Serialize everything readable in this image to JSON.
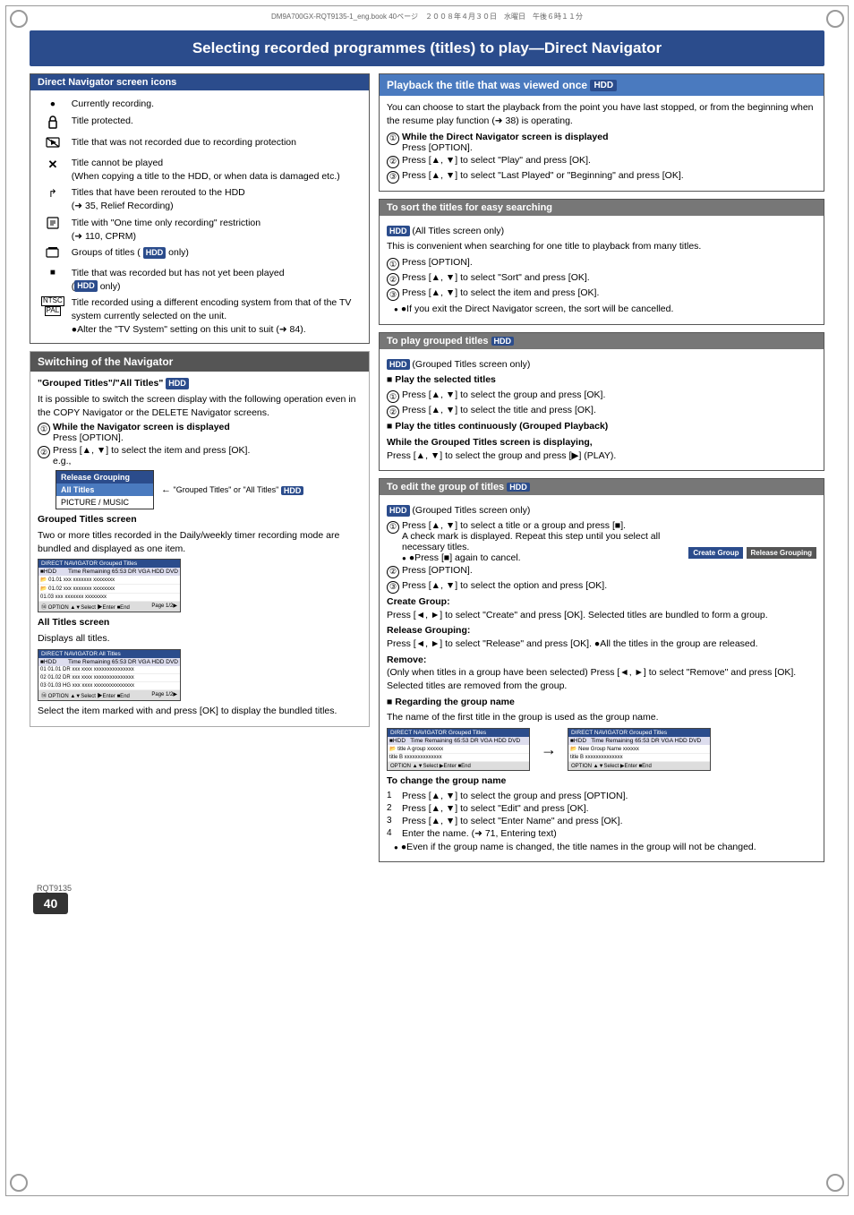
{
  "page": {
    "title": "Selecting recorded programmes (titles) to play—Direct Navigator",
    "meta_line": "DM9A700GX-RQT9135-1_eng.book  40ページ　２００８年４月３０日　水曜日　午後６時１１分",
    "page_number": "40",
    "page_ref": "RQT9135"
  },
  "left": {
    "icons_box": {
      "title": "Direct Navigator screen icons",
      "icons": [
        {
          "icon": "●",
          "description": "Currently recording."
        },
        {
          "icon": "🔒",
          "description": "Title protected."
        },
        {
          "icon": "📷",
          "description": "Title that was not recorded due to recording protection"
        },
        {
          "icon": "✕",
          "description": "Title cannot be played\n(When copying a title to the HDD, or when data is damaged etc.)"
        },
        {
          "icon": "↱",
          "description": "Titles that have been rerouted to the HDD\n(➜ 35, Relief Recording)"
        },
        {
          "icon": "📋",
          "description": "Title with \"One time only recording\" restriction\n(➜ 110, CPRM)"
        },
        {
          "icon": "🔄",
          "description": "Groups of titles ( HDD only)"
        },
        {
          "icon": "▪",
          "description": "Title that was recorded but has not yet been played\n(HDD only)"
        },
        {
          "icon": "NTSC/PAL",
          "description": "Title recorded using a different encoding system from that of the TV system currently selected on the unit.\n●Alter the \"TV System\" setting on this unit to suit (➜ 84)."
        }
      ]
    },
    "switching_box": {
      "title": "Switching of the Navigator",
      "subtitle": "\"Grouped Titles\"/\"All Titles\" HDD",
      "intro": "It is possible to switch the screen display with the following operation even in the COPY Navigator or the DELETE Navigator screens.",
      "steps": [
        {
          "num": "①",
          "text": "While the Navigator screen is displayed\nPress [OPTION]."
        },
        {
          "num": "②",
          "text": "Press [▲, ▼] to select the item and press [OK].\ne.g.,"
        }
      ],
      "caption": "\"Grouped Titles\" or \"All Titles\" HDD",
      "grouped_title_screen": {
        "label": "Grouped Titles screen",
        "description": "Two or more titles recorded in the Daily/weekly timer recording mode are bundled and displayed as one item."
      },
      "all_titles_screen": {
        "label": "All Titles screen",
        "description": "Displays all titles."
      },
      "select_note": "Select the item marked with  and press [OK] to display the bundled titles."
    }
  },
  "right": {
    "playback_box": {
      "title": "Playback the title that was viewed once",
      "hdd": "HDD",
      "intro": "You can choose to start the playback from the point you have last stopped, or from the beginning when the resume play function (➜ 38) is operating.",
      "steps": [
        {
          "num": "①",
          "text": "While the Direct Navigator screen is displayed\nPress [OPTION]."
        },
        {
          "num": "②",
          "text": "Press [▲, ▼] to select \"Play\" and press [OK]."
        },
        {
          "num": "③",
          "text": "Press [▲, ▼] to select \"Last Played\" or \"Beginning\" and press [OK]."
        }
      ]
    },
    "sort_box": {
      "title": "To sort the titles for easy searching",
      "hdd": "HDD",
      "subtitle": "(All Titles screen only)",
      "intro": "This is convenient when searching for one title to playback from many titles.",
      "steps": [
        {
          "num": "①",
          "text": "Press [OPTION]."
        },
        {
          "num": "②",
          "text": "Press [▲, ▼] to select \"Sort\" and press [OK]."
        },
        {
          "num": "③",
          "text": "Press [▲, ▼] to select the item and press [OK]."
        }
      ],
      "note": "●If you exit the Direct Navigator screen, the sort will be cancelled."
    },
    "play_grouped_box": {
      "title": "To play grouped titles",
      "hdd": "HDD",
      "subtitle": "(Grouped Titles screen only)",
      "play_selected_title": "■ Play the selected titles",
      "play_selected_steps": [
        {
          "num": "①",
          "text": "Press [▲, ▼] to select the group and press [OK]."
        },
        {
          "num": "②",
          "text": "Press [▲, ▼] to select the title and press [OK]."
        }
      ],
      "play_continuous_title": "■ Play the titles continuously (Grouped Playback)",
      "play_continuous_text": "While the Grouped Titles screen is displaying,\nPress [▲, ▼] to select the group and press [▶] (PLAY)."
    },
    "edit_group_box": {
      "title": "To edit the group of titles",
      "hdd": "HDD",
      "subtitle": "(Grouped Titles screen only)",
      "steps": [
        {
          "num": "①",
          "text": "Press [▲, ▼] to select a title or a group and press [■].\nA check mark is displayed. Repeat this step until you select all necessary titles.\n●Press [■] again to cancel."
        },
        {
          "num": "②",
          "text": "Press [OPTION]."
        },
        {
          "num": "③",
          "text": "Press [▲, ▼] to select the option and press [OK]."
        }
      ],
      "create_group": {
        "label": "Create Group:",
        "text": "Press [◄, ►] to select \"Create\" and press [OK].\nSelected titles are bundled to form a group."
      },
      "release_grouping": {
        "label": "Release Grouping:",
        "text": "Press [◄, ►] to select \"Release\" and press [OK].\n●All the titles in the group are released."
      },
      "remove": {
        "label": "Remove:",
        "text": "(Only when titles in a group have been selected)\nPress [◄, ►] to select \"Remove\" and press [OK].\nSelected titles are removed from the group."
      },
      "group_name_title": "■ Regarding the group name",
      "group_name_text": "The name of the first title in the group is used as the group name.",
      "change_group_name_title": "To change the group name",
      "change_steps": [
        {
          "num": "1",
          "text": "Press [▲, ▼] to select the group and press [OPTION]."
        },
        {
          "num": "2",
          "text": "Press [▲, ▼] to select \"Edit\" and press [OK]."
        },
        {
          "num": "3",
          "text": "Press [▲, ▼] to select \"Enter Name\" and press [OK]."
        },
        {
          "num": "4",
          "text": "Enter the name. (➜ 71, Entering text)"
        }
      ],
      "change_note": "●Even if the group name is changed, the title names in the group will not be changed."
    }
  }
}
